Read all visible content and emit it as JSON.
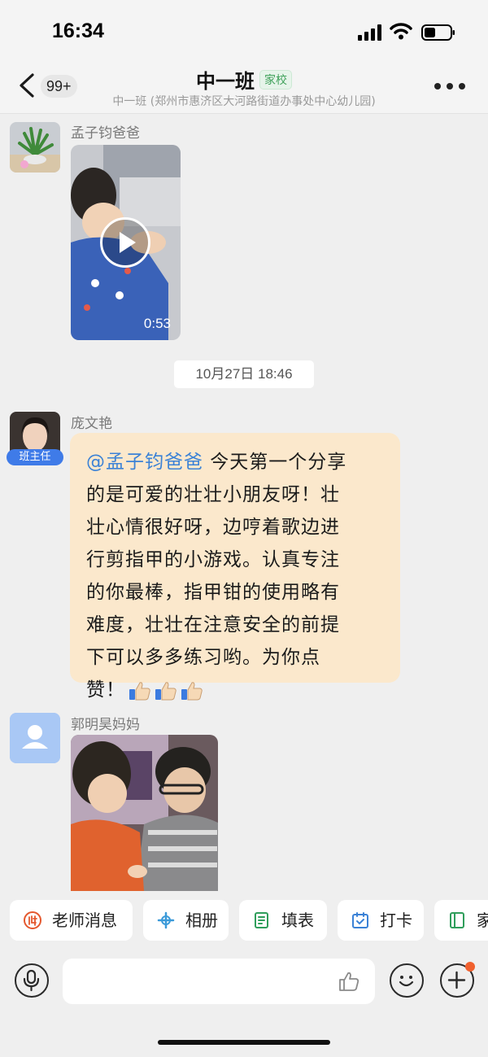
{
  "status_bar": {
    "time": "16:34"
  },
  "header": {
    "unread_count": "99+",
    "title": "中一班",
    "tag": "家校",
    "subtitle": "中一班 (郑州市惠济区大河路街道办事处中心幼儿园)"
  },
  "messages": [
    {
      "sender": "孟子钧爸爸",
      "type": "video",
      "duration": "0:53"
    },
    {
      "type": "timestamp",
      "text": "10月27日 18:46"
    },
    {
      "sender": "庞文艳",
      "role": "班主任",
      "type": "text",
      "mention": "@孟子钧爸爸",
      "lines": [
        " 今天第一个分享",
        "的是可爱的壮壮小朋友呀！壮",
        "壮心情很好呀，边哼着歌边进",
        "行剪指甲的小游戏。认真专注",
        "的你最棒，指甲钳的使用略有",
        "难度，壮壮在注意安全的前提",
        "下可以多多练习哟。为你点",
        "赞！"
      ]
    },
    {
      "sender": "郭明昊妈妈",
      "type": "image"
    }
  ],
  "quick_actions": [
    {
      "label": "老师消息",
      "icon": "teacher-icon"
    },
    {
      "label": "相册",
      "icon": "album-icon"
    },
    {
      "label": "填表",
      "icon": "form-icon"
    },
    {
      "label": "打卡",
      "icon": "checkin-icon"
    },
    {
      "label": "家",
      "icon": "home-book-icon"
    }
  ],
  "colors": {
    "mention": "#3b82d6",
    "bubble": "#fbe8cc",
    "role_badge": "#3f7be8",
    "tag_green": "#3fa15a",
    "accent_orange": "#f0602e"
  }
}
